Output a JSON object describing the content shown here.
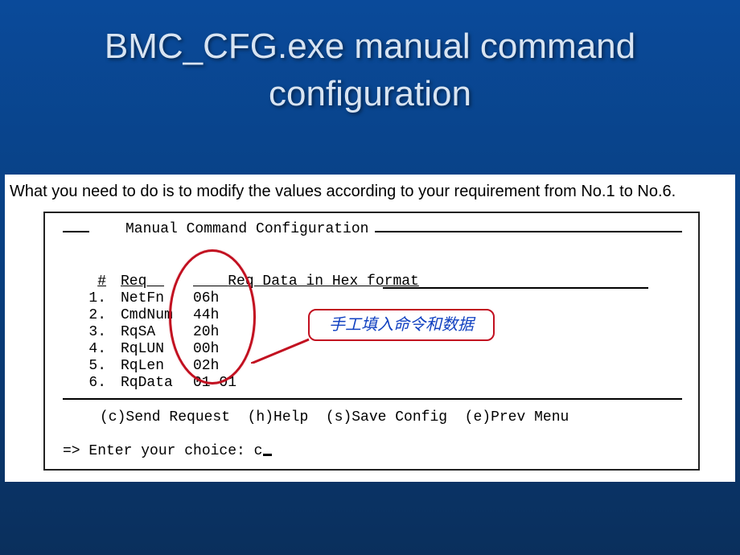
{
  "slide": {
    "title": "BMC_CFG.exe manual command configuration"
  },
  "instruction": "What you need to do is to modify the values according to your requirement from No.1 to No.6.",
  "terminal": {
    "header_label": "Manual Command Configuration",
    "columns": {
      "num": "#",
      "req": "Req",
      "data_label": "Req Data in Hex format"
    },
    "rows": [
      {
        "n": "1.",
        "req": "NetFn",
        "val": "06h"
      },
      {
        "n": "2.",
        "req": "CmdNum",
        "val": "44h"
      },
      {
        "n": "3.",
        "req": "RqSA",
        "val": "20h"
      },
      {
        "n": "4.",
        "req": "RqLUN",
        "val": "00h"
      },
      {
        "n": "5.",
        "req": "RqLen",
        "val": "02h"
      },
      {
        "n": "6.",
        "req": "RqData",
        "val": "01 01"
      }
    ],
    "footer_menu": "(c)Send Request  (h)Help  (s)Save Config  (e)Prev Menu",
    "prompt": "=> Enter your choice: ",
    "input": "c"
  },
  "callout": {
    "text": "手工填入命令和数据"
  }
}
